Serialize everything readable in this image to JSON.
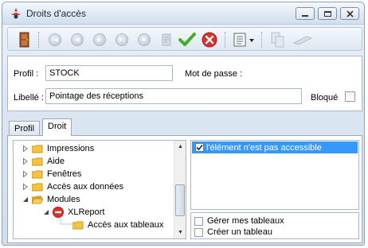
{
  "window": {
    "title": "Droits d'accès"
  },
  "toolbar": {
    "buttons": [
      {
        "name": "exit",
        "icon": "door-exit-icon"
      },
      {
        "name": "first",
        "icon": "first-record-icon"
      },
      {
        "name": "previous",
        "icon": "previous-record-icon"
      },
      {
        "name": "next",
        "icon": "next-record-icon"
      },
      {
        "name": "last",
        "icon": "last-record-icon"
      },
      {
        "name": "new",
        "icon": "new-record-icon"
      },
      {
        "name": "edit",
        "icon": "edit-record-icon"
      },
      {
        "name": "validate",
        "icon": "checkmark-icon"
      },
      {
        "name": "cancel",
        "icon": "cancel-icon"
      },
      {
        "name": "menu",
        "icon": "list-menu-icon"
      },
      {
        "name": "copy",
        "icon": "copy-icon"
      },
      {
        "name": "tool",
        "icon": "tool-icon"
      }
    ]
  },
  "form": {
    "profil_label": "Profil :",
    "profil_value": "STOCK",
    "password_label": "Mot de passe :",
    "libelle_label": "Libellé :",
    "libelle_value": "Pointage des réceptions",
    "bloque_label": "Bloqué",
    "bloque_checked": false
  },
  "tabs": [
    {
      "label": "Profil",
      "active": false
    },
    {
      "label": "Droit",
      "active": true
    }
  ],
  "tree": {
    "items": [
      {
        "label": "Impressions",
        "level": 0,
        "expanded": false,
        "type": "folder"
      },
      {
        "label": "Aide",
        "level": 0,
        "expanded": false,
        "type": "folder"
      },
      {
        "label": "Fenêtres",
        "level": 0,
        "expanded": false,
        "type": "folder"
      },
      {
        "label": "Accès aux données",
        "level": 0,
        "expanded": false,
        "type": "folder"
      },
      {
        "label": "Modules",
        "level": 0,
        "expanded": true,
        "type": "folder-open"
      },
      {
        "label": "XLReport",
        "level": 1,
        "expanded": true,
        "type": "denied"
      },
      {
        "label": "Accès aux tableaux",
        "level": 2,
        "expanded": false,
        "type": "folder"
      }
    ]
  },
  "rights": {
    "item_label": "l'élément n'est pas accessible",
    "item_checked": true,
    "options": [
      {
        "label": "Gérer mes tableaux",
        "checked": false
      },
      {
        "label": "Créer un tableau",
        "checked": false
      }
    ]
  },
  "colors": {
    "selection": "#3399ff",
    "folder": "#f5c342",
    "validate": "#3fae2a",
    "cancel": "#d9302b"
  }
}
